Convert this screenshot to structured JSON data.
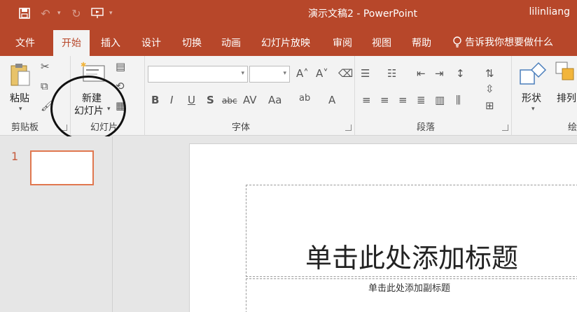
{
  "app": {
    "title": "演示文稿2 - PowerPoint",
    "user": "lilinliang",
    "accent": "#b7472a"
  },
  "qat": {
    "save_icon": "save-icon",
    "undo_icon": "undo-icon",
    "redo_icon": "redo-icon",
    "present_icon": "present-icon",
    "customize_icon": "customize-icon"
  },
  "tabs": [
    {
      "label": "文件"
    },
    {
      "label": "开始",
      "active": true
    },
    {
      "label": "插入"
    },
    {
      "label": "设计"
    },
    {
      "label": "切换"
    },
    {
      "label": "动画"
    },
    {
      "label": "幻灯片放映"
    },
    {
      "label": "审阅"
    },
    {
      "label": "视图"
    },
    {
      "label": "帮助"
    }
  ],
  "tell_me": "告诉我你想要做什么",
  "ribbon": {
    "clipboard": {
      "paste": "粘贴",
      "label": "剪贴板"
    },
    "slides": {
      "new_line1": "新建",
      "new_line2": "幻灯片",
      "label": "幻灯片"
    },
    "font": {
      "label": "字体"
    },
    "paragraph": {
      "label": "段落"
    },
    "drawing": {
      "shapes": "形状",
      "arrange": "排列",
      "label": "绘"
    }
  },
  "slide_pane": {
    "slide_number": "1"
  },
  "slide": {
    "title_placeholder": "单击此处添加标题",
    "subtitle_placeholder": "单击此处添加副标题"
  }
}
